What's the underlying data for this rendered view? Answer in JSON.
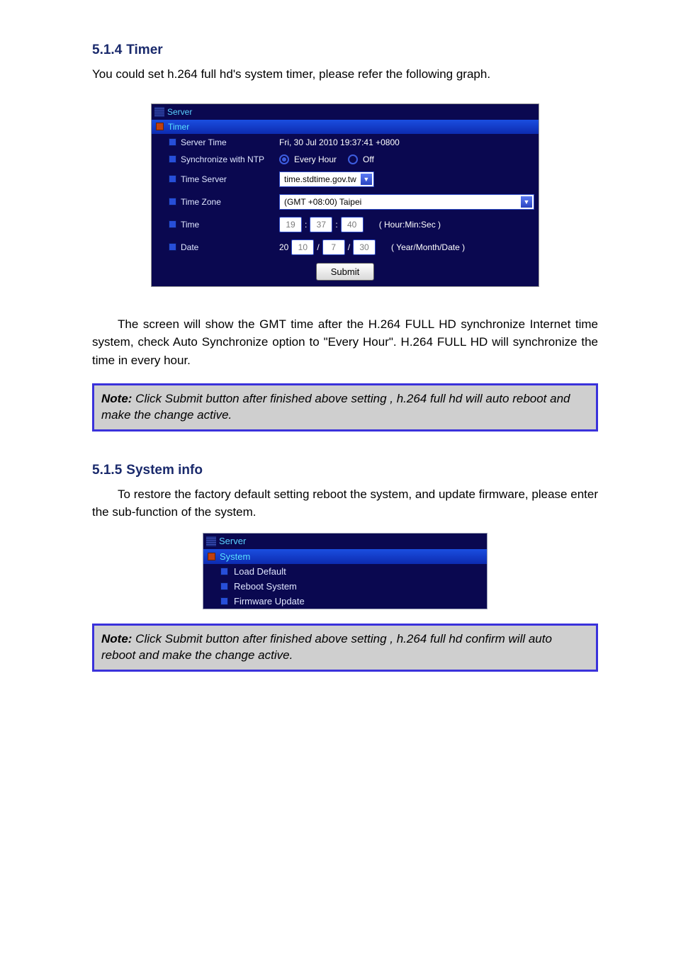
{
  "section_timer": {
    "heading_number": "5.1.4",
    "heading_text": "Timer",
    "para1_lead": "You could set h.264 full hd",
    "para1_tail": "'s system timer, please refer the following graph.",
    "para2": "The screen will show the GMT time after the H.264 FULL HD synchronize Internet time system, check Auto Synchronize option to \"Every Hour\".    H.264 FULL HD will synchronize the time in every hour."
  },
  "panel_timer": {
    "panel_title": "Server",
    "section_title": "Timer",
    "rows": {
      "server_time": {
        "label": "Server Time",
        "value": "Fri, 30 Jul 2010 19:37:41 +0800"
      },
      "sync_ntp": {
        "label": "Synchronize with NTP",
        "opt_every": "Every Hour",
        "opt_off": "Off"
      },
      "time_server": {
        "label": "Time Server",
        "value": "time.stdtime.gov.tw"
      },
      "time_zone": {
        "label": "Time Zone",
        "value": "(GMT +08:00) Taipei"
      },
      "time": {
        "label": "Time",
        "h": "19",
        "m": "37",
        "s": "40",
        "unit": "( Hour:Min:Sec )"
      },
      "date": {
        "label": "Date",
        "prefix": "20",
        "y": "10",
        "mo": "7",
        "d": "30",
        "unit": "( Year/Month/Date )"
      }
    },
    "submit_label": "Submit"
  },
  "note1": {
    "head": "Note:",
    "body": " Click Submit button after finished above setting , h.264 full hd will auto reboot and make the change active."
  },
  "section_system": {
    "heading_number": "5.1.5",
    "heading_text": "System info",
    "para": "To restore the factory default setting reboot the system, and update firmware, please enter the sub-function of the system."
  },
  "panel_system": {
    "panel_title": "Server",
    "section_title": "System",
    "items": {
      "load_default": "Load Default",
      "reboot_system": "Reboot System",
      "firmware_update": "Firmware Update"
    }
  },
  "note2": {
    "head": "Note:",
    "body": " Click Submit button after finished above setting , h.264 full hd confirm will auto reboot and make the change active."
  }
}
